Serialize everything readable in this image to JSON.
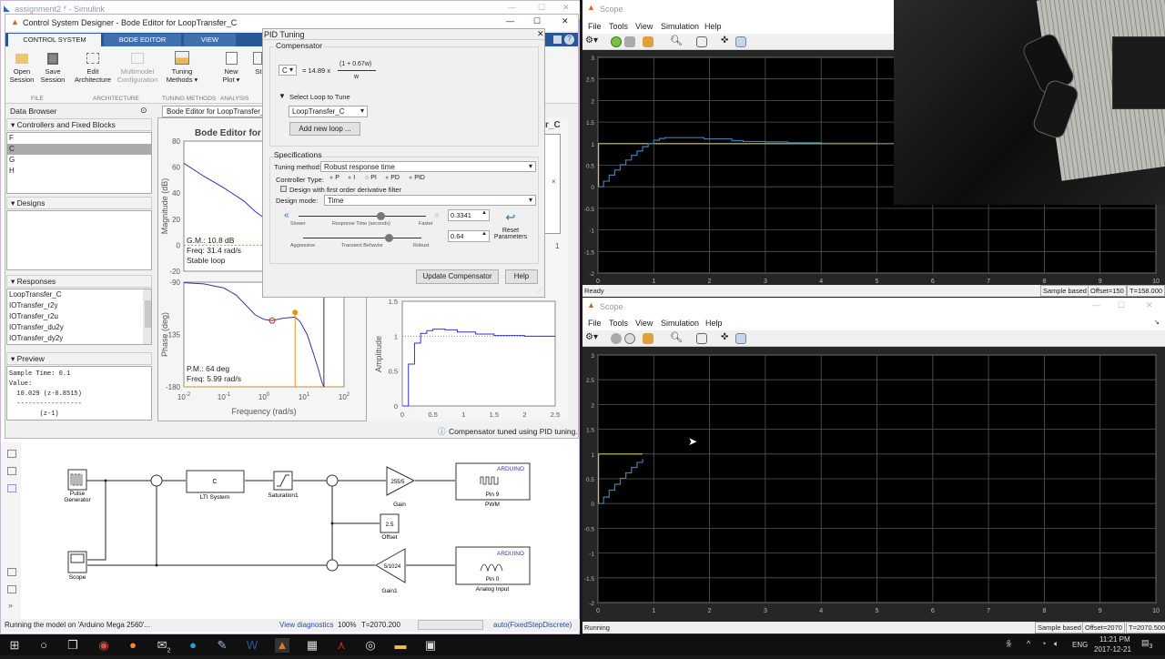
{
  "simulink": {
    "title": "assignment2 * - Simulink",
    "blocks": {
      "pulse_l1": "Pulse",
      "pulse_l2": "Generator",
      "lti_value": "C",
      "lti_label": "LTI System",
      "saturation_label": "Saturation1",
      "gain_value": "255/5",
      "gain_label": "Gain",
      "pwm_brand": "ARDUINO",
      "pwm_pin": "Pin 9",
      "pwm_label": "PWM",
      "offset_value": "2.5",
      "offset_label": "Offset",
      "scope_label": "Scope",
      "gain1_value": "5/1024",
      "gain1_label": "Gain1",
      "ain_brand": "ARDUINO",
      "ain_pin": "Pin 0",
      "ain_label": "Analog Input"
    },
    "status": {
      "message": "Running the model on 'Arduino Mega 2560'...",
      "diagnostics": "View diagnostics",
      "zoom": "100%",
      "time": "T=2070.200",
      "solver": "auto(FixedStepDiscrete)"
    }
  },
  "csd": {
    "title": "Control System Designer - Bode Editor for LoopTransfer_C",
    "tabs": [
      "CONTROL SYSTEM",
      "BODE EDITOR",
      "VIEW"
    ],
    "ribbon": {
      "open": [
        "Open",
        "Session"
      ],
      "save": [
        "Save",
        "Session"
      ],
      "edit": [
        "Edit",
        "Architecture"
      ],
      "multimodel": [
        "Multimodel",
        "Configuration"
      ],
      "tuning": [
        "Tuning",
        "Methods ▾"
      ],
      "newplot": [
        "New",
        "Plot ▾"
      ],
      "st": "St",
      "sections": [
        "FILE",
        "ARCHITECTURE",
        "TUNING METHODS",
        "ANALYSIS"
      ]
    },
    "browser": {
      "title": "Data Browser",
      "controllers_title": "Controllers and Fixed Blocks",
      "controllers": [
        "F",
        "C",
        "G",
        "H"
      ],
      "designs_title": "Designs",
      "responses_title": "Responses",
      "responses": [
        "LoopTransfer_C",
        "IOTransfer_r2y",
        "IOTransfer_r2u",
        "IOTransfer_du2y",
        "IOTransfer_dy2y"
      ],
      "preview_title": "Preview",
      "preview": [
        "Sample Time: 0.1",
        "Value:",
        "  10.029 (z-0.8515)",
        "  -----------------",
        "        (z-1)"
      ]
    },
    "bode_tab": "Bode Editor for LoopTransfer_",
    "bode_title": "Bode Editor for",
    "rl_title_fragment": "r_C",
    "rl_tick": "1",
    "gm": [
      "G.M.: 10.8 dB",
      "Freq: 31.4 rad/s",
      "Stable loop"
    ],
    "pm": [
      "P.M.: 64 deg",
      "Freq: 5.99 rad/s"
    ],
    "status": "Compensator tuned using PID tuning."
  },
  "pid": {
    "title": "PID Tuning",
    "compensator_title": "Compensator",
    "comp_select": "C",
    "equation_gain": "=  14.89 x",
    "numerator": "(1 + 0.67w)",
    "denominator": "w",
    "select_loop": "Select Loop to Tune",
    "loop": "LoopTransfer_C",
    "add_loop": "Add new loop ...",
    "spec_title": "Specifications",
    "tuning_method_label": "Tuning method:",
    "tuning_method": "Robust response time",
    "controller_type_label": "Controller Type:",
    "controller_types": [
      "P",
      "I",
      "PI",
      "PD",
      "PID"
    ],
    "controller_selected": "PI",
    "filter_label": "Design with first order derivative filter",
    "filter_checked": false,
    "design_mode_label": "Design mode:",
    "design_mode": "Time",
    "rt": {
      "slower": "Slower",
      "label": "Response Time (seconds)",
      "faster": "Faster",
      "value": "0.3341",
      "position": 0.64
    },
    "tb": {
      "aggressive": "Aggressive",
      "label": "Transient Behavior",
      "robust": "Robust",
      "value": "0.64",
      "position": 0.72
    },
    "reset": [
      "Reset",
      "Parameters"
    ],
    "update": "Update Compensator",
    "help": "Help"
  },
  "scope1": {
    "title": "Scope",
    "menu": [
      "File",
      "Tools",
      "View",
      "Simulation",
      "Help"
    ],
    "status": "Ready",
    "mode": "Sample based",
    "offset": "Offset=150",
    "time": "T=158.000"
  },
  "scope2": {
    "title": "Scope",
    "menu": [
      "File",
      "Tools",
      "View",
      "Simulation",
      "Help"
    ],
    "status": "Running",
    "mode": "Sample based",
    "offset": "Offset=2070",
    "time": "T=2070.500"
  },
  "taskbar": {
    "mail_badge": "2",
    "lang": "ENG",
    "clock": "11:21 PM",
    "date": "2017-12-21",
    "notifications": "3"
  },
  "colors": {
    "ribbon_blue": "#2b5797",
    "bode_line": "#3333aa",
    "margin": "#e69500",
    "scope_ref": "#c8c850",
    "scope_resp": "#3d7fb0"
  },
  "chart_data": [
    {
      "id": "bode-mag",
      "type": "line",
      "ylabel": "Magnitude (dB)",
      "xscale": "log",
      "xlim": [
        0.01,
        100
      ],
      "ylim": [
        -20,
        80
      ],
      "yticks": [
        80,
        60,
        40,
        20,
        0,
        -20
      ],
      "series": [
        {
          "name": "LoopTransfer_C",
          "x": [
            0.01,
            0.0316,
            0.1,
            0.316,
            0.6,
            1,
            2,
            4,
            10,
            20,
            31.4,
            60,
            100
          ],
          "y": [
            63,
            53,
            44,
            34,
            26,
            21,
            14,
            6,
            -4,
            -12,
            -17,
            -20,
            -20
          ]
        }
      ]
    },
    {
      "id": "bode-phase",
      "type": "line",
      "ylabel": "Phase (deg)",
      "xlabel": "Frequency (rad/s)",
      "xscale": "log",
      "xlim": [
        0.01,
        100
      ],
      "ylim": [
        -180,
        -90
      ],
      "yticks": [
        -90,
        -135,
        -180
      ],
      "xticks": [
        "10^-2",
        "10^-1",
        "10^0",
        "10^1",
        "10^2"
      ],
      "series": [
        {
          "name": "LoopTransfer_C",
          "x": [
            0.01,
            0.0316,
            0.1,
            0.2,
            0.316,
            0.6,
            1,
            1.6,
            3,
            5.99,
            8,
            12,
            16,
            22,
            28,
            31.4
          ],
          "y": [
            -90.5,
            -91.5,
            -95,
            -101,
            -108,
            -118,
            -122,
            -123,
            -121,
            -120,
            -124,
            -135,
            -148,
            -163,
            -176,
            -180
          ]
        }
      ],
      "pm_freq": 5.99,
      "pm_phase": -116
    },
    {
      "id": "step",
      "type": "line",
      "ylabel": "Amplitude",
      "xlim": [
        0,
        2.5
      ],
      "ylim": [
        0,
        1.5
      ],
      "xticks": [
        0,
        0.5,
        1,
        1.5,
        2,
        2.5
      ],
      "yticks": [
        0,
        0.5,
        1,
        1.5
      ],
      "series": [
        {
          "name": "step",
          "stairs": true,
          "x": [
            0,
            0.1,
            0.2,
            0.3,
            0.4,
            0.5,
            0.7,
            0.9,
            1.2,
            1.5,
            2,
            2.5
          ],
          "y": [
            0,
            0.6,
            0.9,
            1.04,
            1.08,
            1.1,
            1.09,
            1.06,
            1.03,
            1.01,
            1.0,
            1.0
          ]
        }
      ]
    },
    {
      "id": "scope1",
      "type": "line",
      "xlim": [
        0,
        10
      ],
      "ylim": [
        -2,
        3
      ],
      "xticks": [
        0,
        1,
        2,
        3,
        4,
        5,
        6,
        7,
        8,
        9,
        10
      ],
      "yticks": [
        3,
        2.5,
        2,
        1.5,
        1,
        0.5,
        0,
        -0.5,
        -1,
        -1.5,
        -2
      ],
      "series": [
        {
          "name": "reference",
          "color": "#c8c850",
          "stairs": true,
          "x": [
            0,
            0.01,
            10
          ],
          "y": [
            0,
            1,
            1
          ]
        },
        {
          "name": "response",
          "color": "#3d7fb0",
          "stairs": true,
          "x": [
            0,
            0.1,
            0.2,
            0.3,
            0.4,
            0.5,
            0.6,
            0.7,
            0.8,
            0.9,
            1.0,
            1.1,
            1.2,
            1.5,
            1.9,
            2.4,
            2.6,
            3.0,
            3.4,
            4.0,
            5.0,
            10
          ],
          "y": [
            0,
            0.13,
            0.27,
            0.39,
            0.51,
            0.62,
            0.73,
            0.83,
            0.93,
            1.0,
            1.08,
            1.12,
            1.14,
            1.14,
            1.11,
            1.07,
            1.05,
            1.04,
            1.02,
            1.01,
            1.0,
            1.0
          ]
        }
      ]
    },
    {
      "id": "scope2",
      "type": "line",
      "xlim": [
        0,
        10
      ],
      "ylim": [
        -2,
        3
      ],
      "xticks": [
        0,
        1,
        2,
        3,
        4,
        5,
        6,
        7,
        8,
        9,
        10
      ],
      "yticks": [
        3,
        2.5,
        2,
        1.5,
        1,
        0.5,
        0,
        -0.5,
        -1,
        -1.5,
        -2
      ],
      "series": [
        {
          "name": "reference",
          "color": "#c8c850",
          "stairs": true,
          "x": [
            0,
            0.01,
            0.8
          ],
          "y": [
            0,
            1,
            1
          ]
        },
        {
          "name": "response",
          "color": "#3d7fb0",
          "stairs": true,
          "x": [
            0,
            0.1,
            0.2,
            0.3,
            0.4,
            0.5,
            0.6,
            0.7,
            0.8
          ],
          "y": [
            0,
            0.13,
            0.27,
            0.39,
            0.51,
            0.62,
            0.73,
            0.83,
            0.9
          ]
        }
      ]
    }
  ]
}
